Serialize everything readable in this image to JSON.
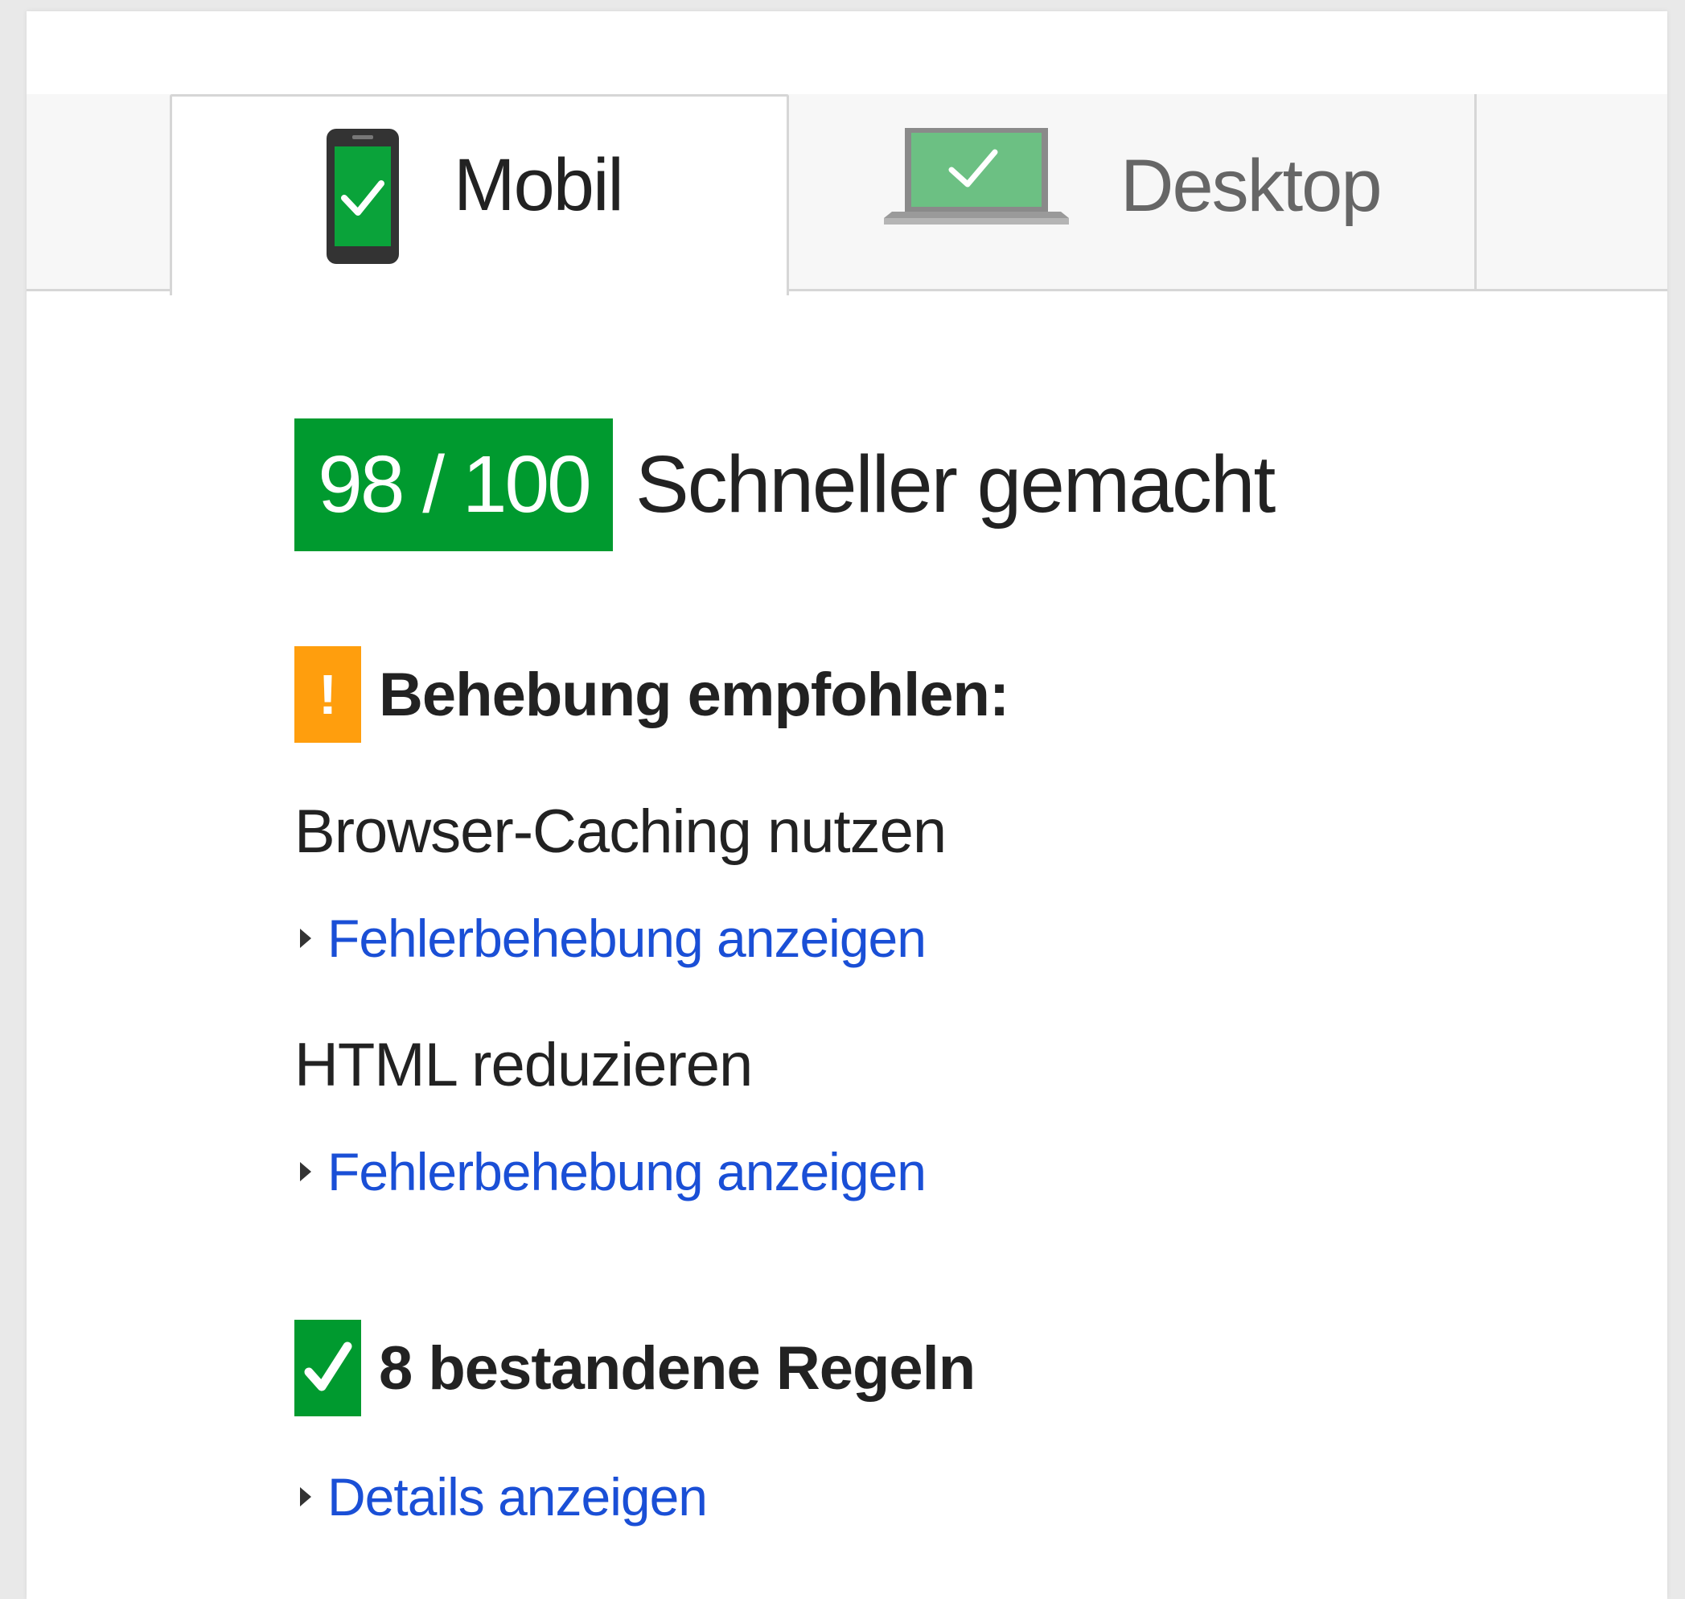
{
  "tabs": [
    {
      "label": "Mobil",
      "icon": "mobile-phone-check-icon",
      "selected": true
    },
    {
      "label": "Desktop",
      "icon": "laptop-check-icon",
      "selected": false
    }
  ],
  "score": {
    "value": "98 / 100",
    "label": "Schneller gemacht",
    "color": "#009a2f"
  },
  "recommended": {
    "title": "Behebung empfohlen:",
    "icon_glyph": "!",
    "icon": "warning-icon",
    "color": "#ff9e0d",
    "rules": [
      {
        "name": "Browser-Caching nutzen",
        "link": "Fehlerbehebung anzeigen"
      },
      {
        "name": "HTML reduzieren",
        "link": "Fehlerbehebung anzeigen"
      }
    ]
  },
  "passed": {
    "title": "8 bestandene Regeln",
    "icon": "checkmark-icon",
    "link": "Details anzeigen",
    "color": "#009a2f"
  },
  "colors": {
    "link": "#1a4fd6",
    "text": "#222222",
    "inactive_tab_text": "#666666"
  }
}
